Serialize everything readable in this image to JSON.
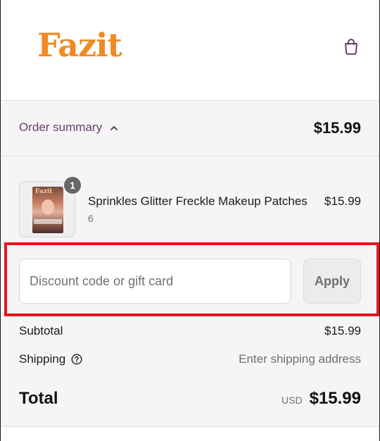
{
  "header": {
    "logo_text": "Fazit",
    "cart_icon": "shopping-bag-icon"
  },
  "summary_bar": {
    "toggle_label": "Order summary",
    "toggle_icon": "chevron-up-icon",
    "total": "$15.99"
  },
  "line_item": {
    "name": "Sprinkles Glitter Freckle Makeup Patches",
    "variant": "6",
    "price": "$15.99",
    "quantity": "1",
    "thumb_brand": "Fazit"
  },
  "discount": {
    "placeholder": "Discount code or gift card",
    "value": "",
    "apply_label": "Apply"
  },
  "totals": {
    "subtotal_label": "Subtotal",
    "subtotal_value": "$15.99",
    "shipping_label": "Shipping",
    "shipping_value": "Enter shipping address",
    "total_label": "Total",
    "currency": "USD",
    "total_value": "$15.99"
  },
  "colors": {
    "brand_orange": "#f08a24",
    "accent_purple": "#6d3b6b",
    "highlight_red": "#e8141c"
  }
}
